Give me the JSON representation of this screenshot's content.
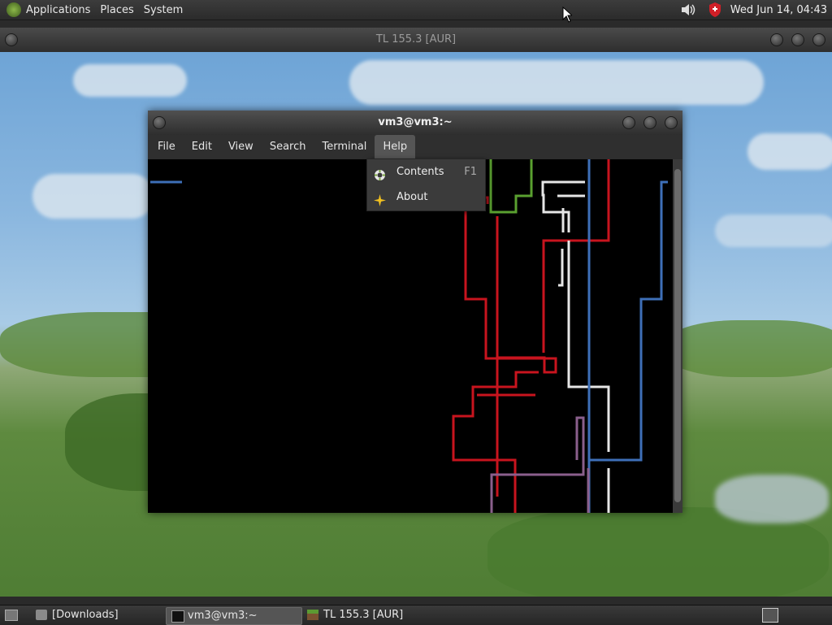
{
  "top_panel": {
    "menus": [
      "Applications",
      "Places",
      "System"
    ],
    "clock": "Wed Jun 14, 04:43",
    "icons": [
      "gnome-foot-icon",
      "volume-icon",
      "shield-icon"
    ]
  },
  "game_window": {
    "title": "TL 155.3 [AUR]"
  },
  "terminal": {
    "title": "vm3@vm3:~",
    "menu": [
      "File",
      "Edit",
      "View",
      "Search",
      "Terminal",
      "Help"
    ],
    "active_menu": "Help"
  },
  "help_menu": {
    "items": [
      {
        "label": "Contents",
        "accel": "F1",
        "icon": "help-contents-icon"
      },
      {
        "label": "About",
        "accel": "",
        "icon": "about-star-icon"
      }
    ]
  },
  "bottom_panel": {
    "tasks": [
      {
        "label": "[Downloads]",
        "icon": "folder-icon",
        "active": false
      },
      {
        "label": "vm3@vm3:~",
        "icon": "terminal-icon",
        "active": true
      },
      {
        "label": "TL 155.3 [AUR]",
        "icon": "grass-block-icon",
        "active": false
      }
    ]
  },
  "colors": {
    "pipe_red": "#c8141e",
    "pipe_blue": "#3e6fb8",
    "pipe_white": "#e6e6e6",
    "pipe_green": "#5aa030",
    "pipe_purple": "#8a5f8c"
  }
}
